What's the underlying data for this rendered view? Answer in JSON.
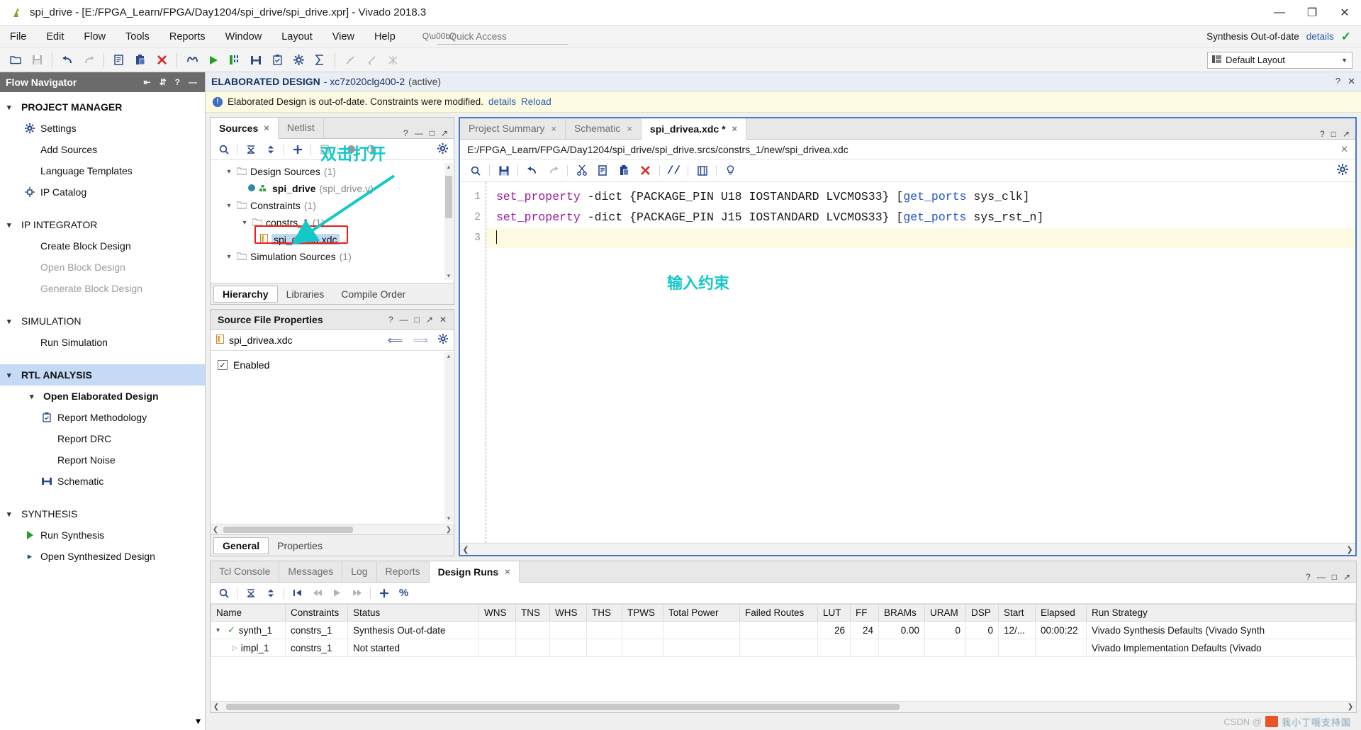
{
  "titlebar": {
    "title": "spi_drive - [E:/FPGA_Learn/FPGA/Day1204/spi_drive/spi_drive.xpr] - Vivado 2018.3",
    "app_icon": "vivado-logo-icon",
    "minimize": "—",
    "maximize": "❐",
    "close": "✕"
  },
  "menu": {
    "items": [
      {
        "label": "File"
      },
      {
        "label": "Edit"
      },
      {
        "label": "Flow"
      },
      {
        "label": "Tools"
      },
      {
        "label": "Reports"
      },
      {
        "label": "Window"
      },
      {
        "label": "Layout"
      },
      {
        "label": "View"
      },
      {
        "label": "Help"
      }
    ],
    "quick_access_placeholder": "Quick Access",
    "synth_status": "Synthesis Out-of-date",
    "details_link": "details"
  },
  "toolbar": {
    "buttons": [
      {
        "name": "open-project-icon",
        "glyph": "◱"
      },
      {
        "name": "save-icon",
        "glyph": "Ὃe"
      },
      {
        "name": "undo-icon",
        "glyph": "↶"
      },
      {
        "name": "redo-icon",
        "glyph": "↷"
      },
      {
        "name": "copy-icon",
        "glyph": "⎘"
      },
      {
        "name": "paste-icon",
        "glyph": "⎗"
      },
      {
        "name": "delete-icon",
        "glyph": "✕"
      },
      {
        "name": "find-icon",
        "glyph": "⚖"
      },
      {
        "name": "run-icon",
        "glyph": "▶"
      },
      {
        "name": "run-synthesis-icon",
        "glyph": "❙"
      },
      {
        "name": "implementation-icon",
        "glyph": "⬛"
      },
      {
        "name": "report-icon",
        "glyph": "Ὄb"
      },
      {
        "name": "settings-icon",
        "glyph": "⚙"
      },
      {
        "name": "sigma-icon",
        "glyph": "Σ"
      },
      {
        "name": "marker1-icon",
        "glyph": "✐"
      },
      {
        "name": "marker2-icon",
        "glyph": "✒"
      },
      {
        "name": "marker3-icon",
        "glyph": "✗"
      }
    ],
    "layout_label": "Default Layout",
    "layout_icon": "grid-icon"
  },
  "flow_navigator": {
    "header": "Flow Navigator",
    "collapse_icon": "collapse-all-icon",
    "expand_icon": "expand-all-icon",
    "help_icon": "help-icon",
    "minimize_icon": "minimize-icon",
    "sections": [
      {
        "title": "PROJECT MANAGER",
        "highlighted": false,
        "items": [
          {
            "label": "Settings",
            "icon": "gear-icon",
            "disabled": false
          },
          {
            "label": "Add Sources",
            "icon": "",
            "disabled": false
          },
          {
            "label": "Language Templates",
            "icon": "",
            "disabled": false
          },
          {
            "label": "IP Catalog",
            "icon": "ip-catalog-icon",
            "disabled": false
          }
        ]
      },
      {
        "title": "IP INTEGRATOR",
        "highlighted": false,
        "items": [
          {
            "label": "Create Block Design",
            "icon": "",
            "disabled": false
          },
          {
            "label": "Open Block Design",
            "icon": "",
            "disabled": true
          },
          {
            "label": "Generate Block Design",
            "icon": "",
            "disabled": true
          }
        ]
      },
      {
        "title": "SIMULATION",
        "highlighted": false,
        "items": [
          {
            "label": "Run Simulation",
            "icon": "",
            "disabled": false
          }
        ]
      },
      {
        "title": "RTL ANALYSIS",
        "highlighted": true,
        "items": [
          {
            "label": "Open Elaborated Design",
            "icon": "chevron-down-icon",
            "disabled": false,
            "bold": true,
            "level": 1
          },
          {
            "label": "Report Methodology",
            "icon": "clipboard-check-icon",
            "disabled": false,
            "level": 2
          },
          {
            "label": "Report DRC",
            "icon": "",
            "disabled": false,
            "level": 2
          },
          {
            "label": "Report Noise",
            "icon": "",
            "disabled": false,
            "level": 2
          },
          {
            "label": "Schematic",
            "icon": "schematic-icon",
            "disabled": false,
            "level": 2
          }
        ]
      },
      {
        "title": "SYNTHESIS",
        "highlighted": false,
        "items": [
          {
            "label": "Run Synthesis",
            "icon": "play-icon",
            "disabled": false
          },
          {
            "label": "Open Synthesized Design",
            "icon": "chevron-right-icon",
            "disabled": false
          }
        ]
      }
    ]
  },
  "design_header": {
    "title": "ELABORATED DESIGN",
    "part": "- xc7z020clg400-2",
    "state": "(active)",
    "help_icon": "?",
    "close_icon": "✕"
  },
  "warning_bar": {
    "icon": "info-icon",
    "text": "Elaborated Design is out-of-date. Constraints were modified.",
    "details_link": "details",
    "reload_link": "Reload"
  },
  "sources_panel": {
    "tabs": [
      {
        "label": "Sources",
        "active": true,
        "closable": true
      },
      {
        "label": "Netlist",
        "active": false,
        "closable": false
      }
    ],
    "window_controls": [
      "?",
      "—",
      "□",
      "↗"
    ],
    "toolbar": [
      {
        "name": "search-icon",
        "glyph": "⚲"
      },
      {
        "name": "collapse-all-icon",
        "glyph": "⩝"
      },
      {
        "name": "expand-all-icon",
        "glyph": "⬍"
      },
      {
        "name": "add-sources-icon",
        "glyph": "+"
      },
      {
        "name": "help-doc-icon",
        "glyph": "⍰"
      },
      {
        "name": "disable-icon",
        "glyph": "●"
      },
      {
        "name": "scope-icon",
        "glyph": "◔"
      }
    ],
    "gear_icon": "gear-icon",
    "tree": [
      {
        "label": "Design Sources",
        "count": "(1)",
        "level": 0,
        "type": "folder",
        "expanded": true
      },
      {
        "label": "spi_drive",
        "sub": "(spi_drive.v)",
        "level": 1,
        "type": "module"
      },
      {
        "label": "Constraints",
        "count": "(1)",
        "level": 0,
        "type": "folder",
        "expanded": true
      },
      {
        "label": "constrs_1",
        "count": "(1)",
        "level": 1,
        "type": "folder",
        "expanded": true
      },
      {
        "label": "spi_drivea.xdc",
        "level": 2,
        "type": "file",
        "selected": true
      },
      {
        "label": "Simulation Sources",
        "count": "(1)",
        "level": 0,
        "type": "folder",
        "expanded": true
      }
    ],
    "bottom_tabs": [
      {
        "label": "Hierarchy",
        "active": true
      },
      {
        "label": "Libraries",
        "active": false
      },
      {
        "label": "Compile Order",
        "active": false
      }
    ]
  },
  "annotations": {
    "double_click_open": "双击打开",
    "enter_constraints": "输入约束",
    "color": "#14c8c8",
    "redbox_color": "#ee1c1c"
  },
  "source_file_properties": {
    "title": "Source File Properties",
    "window_controls": [
      "?",
      "—",
      "□",
      "↗",
      "✕"
    ],
    "file_name": "spi_drivea.xdc",
    "file_icon": "xdc-file-icon",
    "nav_back_icon": "arrow-left-icon",
    "nav_fwd_icon": "arrow-right-icon",
    "gear_icon": "gear-icon",
    "enabled_label": "Enabled",
    "enabled_checked": true,
    "tabs": [
      {
        "label": "General",
        "active": true
      },
      {
        "label": "Properties",
        "active": false
      }
    ]
  },
  "editor": {
    "tabs": [
      {
        "label": "Project Summary",
        "active": false,
        "closable": true
      },
      {
        "label": "Schematic",
        "active": false,
        "closable": true
      },
      {
        "label": "spi_drivea.xdc *",
        "active": true,
        "closable": true
      }
    ],
    "window_controls": [
      "?",
      "□",
      "↗"
    ],
    "path": "E:/FPGA_Learn/FPGA/Day1204/spi_drive/spi_drive.srcs/constrs_1/new/spi_drivea.xdc",
    "path_close": "✕",
    "toolbar": [
      {
        "name": "search-icon",
        "glyph": "⚲"
      },
      {
        "name": "save-file-icon",
        "glyph": "Ὃe"
      },
      {
        "name": "undo-icon",
        "glyph": "↶"
      },
      {
        "name": "redo-icon",
        "glyph": "↷"
      },
      {
        "name": "cut-icon",
        "glyph": "✂"
      },
      {
        "name": "copy-icon",
        "glyph": "⎘"
      },
      {
        "name": "paste-icon",
        "glyph": "⎗"
      },
      {
        "name": "delete-icon",
        "glyph": "✕"
      },
      {
        "name": "comment-icon",
        "glyph": "//"
      },
      {
        "name": "indent-icon",
        "glyph": "☷"
      },
      {
        "name": "hint-icon",
        "glyph": "Ὂ1"
      }
    ],
    "gear_icon": "gear-icon",
    "lines": [
      {
        "num": "1",
        "current": false,
        "tokens": [
          {
            "t": "set_property",
            "c": "kw"
          },
          {
            "t": " -dict {PACKAGE_PIN U18 IOSTANDARD LVCMOS33} [",
            "c": "plain"
          },
          {
            "t": "get_ports",
            "c": "fn"
          },
          {
            "t": " sys_clk]",
            "c": "plain"
          }
        ]
      },
      {
        "num": "2",
        "current": false,
        "tokens": [
          {
            "t": "set_property",
            "c": "kw"
          },
          {
            "t": " -dict {PACKAGE_PIN J15 IOSTANDARD LVCMOS33} [",
            "c": "plain"
          },
          {
            "t": "get_ports",
            "c": "fn"
          },
          {
            "t": " sys_rst_n]",
            "c": "plain"
          }
        ]
      },
      {
        "num": "3",
        "current": true,
        "tokens": []
      }
    ]
  },
  "bottom_panel": {
    "tabs": [
      {
        "label": "Tcl Console",
        "active": false,
        "closable": false
      },
      {
        "label": "Messages",
        "active": false,
        "closable": false
      },
      {
        "label": "Log",
        "active": false,
        "closable": false
      },
      {
        "label": "Reports",
        "active": false,
        "closable": false
      },
      {
        "label": "Design Runs",
        "active": true,
        "closable": true
      }
    ],
    "window_controls": [
      "?",
      "—",
      "□",
      "↗"
    ],
    "toolbar": [
      {
        "name": "search-icon",
        "glyph": "⚲"
      },
      {
        "name": "collapse-all-icon",
        "glyph": "⩝"
      },
      {
        "name": "expand-all-icon",
        "glyph": "⬍"
      },
      {
        "name": "first-icon",
        "glyph": "⏮"
      },
      {
        "name": "prev-icon",
        "glyph": "«"
      },
      {
        "name": "run-icon",
        "glyph": "▶"
      },
      {
        "name": "next-icon",
        "glyph": "»"
      },
      {
        "name": "add-run-icon",
        "glyph": "+"
      },
      {
        "name": "percent-icon",
        "glyph": "%"
      }
    ],
    "columns": [
      "Name",
      "Constraints",
      "Status",
      "WNS",
      "TNS",
      "WHS",
      "THS",
      "TPWS",
      "Total Power",
      "Failed Routes",
      "LUT",
      "FF",
      "BRAMs",
      "URAM",
      "DSP",
      "Start",
      "Elapsed",
      "Run Strategy"
    ],
    "rows": [
      {
        "name": "synth_1",
        "icon": "status-ok-icon",
        "indent": 0,
        "expanded": true,
        "cells": {
          "Constraints": "constrs_1",
          "Status": "Synthesis Out-of-date",
          "WNS": "",
          "TNS": "",
          "WHS": "",
          "THS": "",
          "TPWS": "",
          "Total Power": "",
          "Failed Routes": "",
          "LUT": "26",
          "FF": "24",
          "BRAMs": "0.00",
          "URAM": "0",
          "DSP": "0",
          "Start": "12/...",
          "Elapsed": "00:00:22",
          "Run Strategy": "Vivado Synthesis Defaults (Vivado Synth"
        }
      },
      {
        "name": "impl_1",
        "icon": "run-pending-icon",
        "indent": 1,
        "expanded": false,
        "cells": {
          "Constraints": "constrs_1",
          "Status": "Not started",
          "WNS": "",
          "TNS": "",
          "WHS": "",
          "THS": "",
          "TPWS": "",
          "Total Power": "",
          "Failed Routes": "",
          "LUT": "",
          "FF": "",
          "BRAMs": "",
          "URAM": "",
          "DSP": "",
          "Start": "",
          "Elapsed": "",
          "Run Strategy": "Vivado Implementation Defaults (Vivado"
        }
      }
    ]
  },
  "watermark": {
    "prefix": "CSDN @",
    "text": "我小丁哦支持国"
  }
}
